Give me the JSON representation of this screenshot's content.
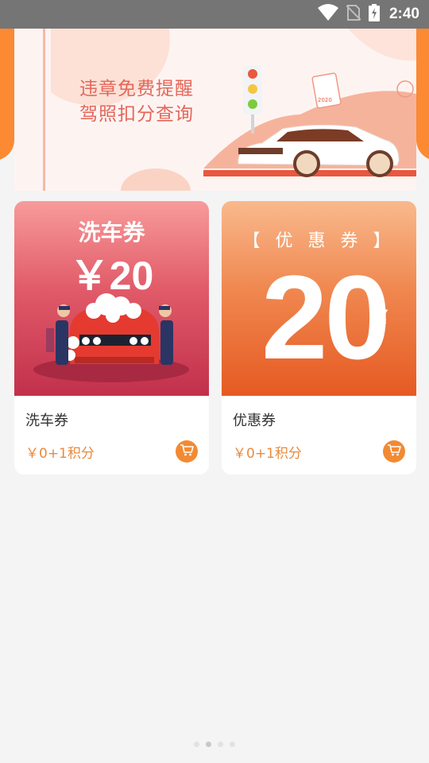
{
  "status_bar": {
    "time": "2:40",
    "icons": [
      "wifi-icon",
      "no-sim-icon",
      "battery-charging-icon"
    ]
  },
  "banner": {
    "line1": "违章免费提醒",
    "line2": "驾照扣分查询",
    "plate_year": "2020"
  },
  "products": [
    {
      "name": "洗车券",
      "price": "￥0+1积分",
      "image_title": "洗车券",
      "image_value": "￥20"
    },
    {
      "name": "优惠券",
      "price": "￥0+1积分",
      "image_title": "【 优 惠 券 】",
      "image_value": "20",
      "image_currency": "￥"
    }
  ],
  "page_indicator": {
    "count": 4,
    "active_index": 1
  },
  "colors": {
    "accent": "#f28a33",
    "price": "#e98a3e",
    "banner_text": "#e4665a",
    "status_bar": "#757575",
    "background": "#f4f4f4"
  }
}
